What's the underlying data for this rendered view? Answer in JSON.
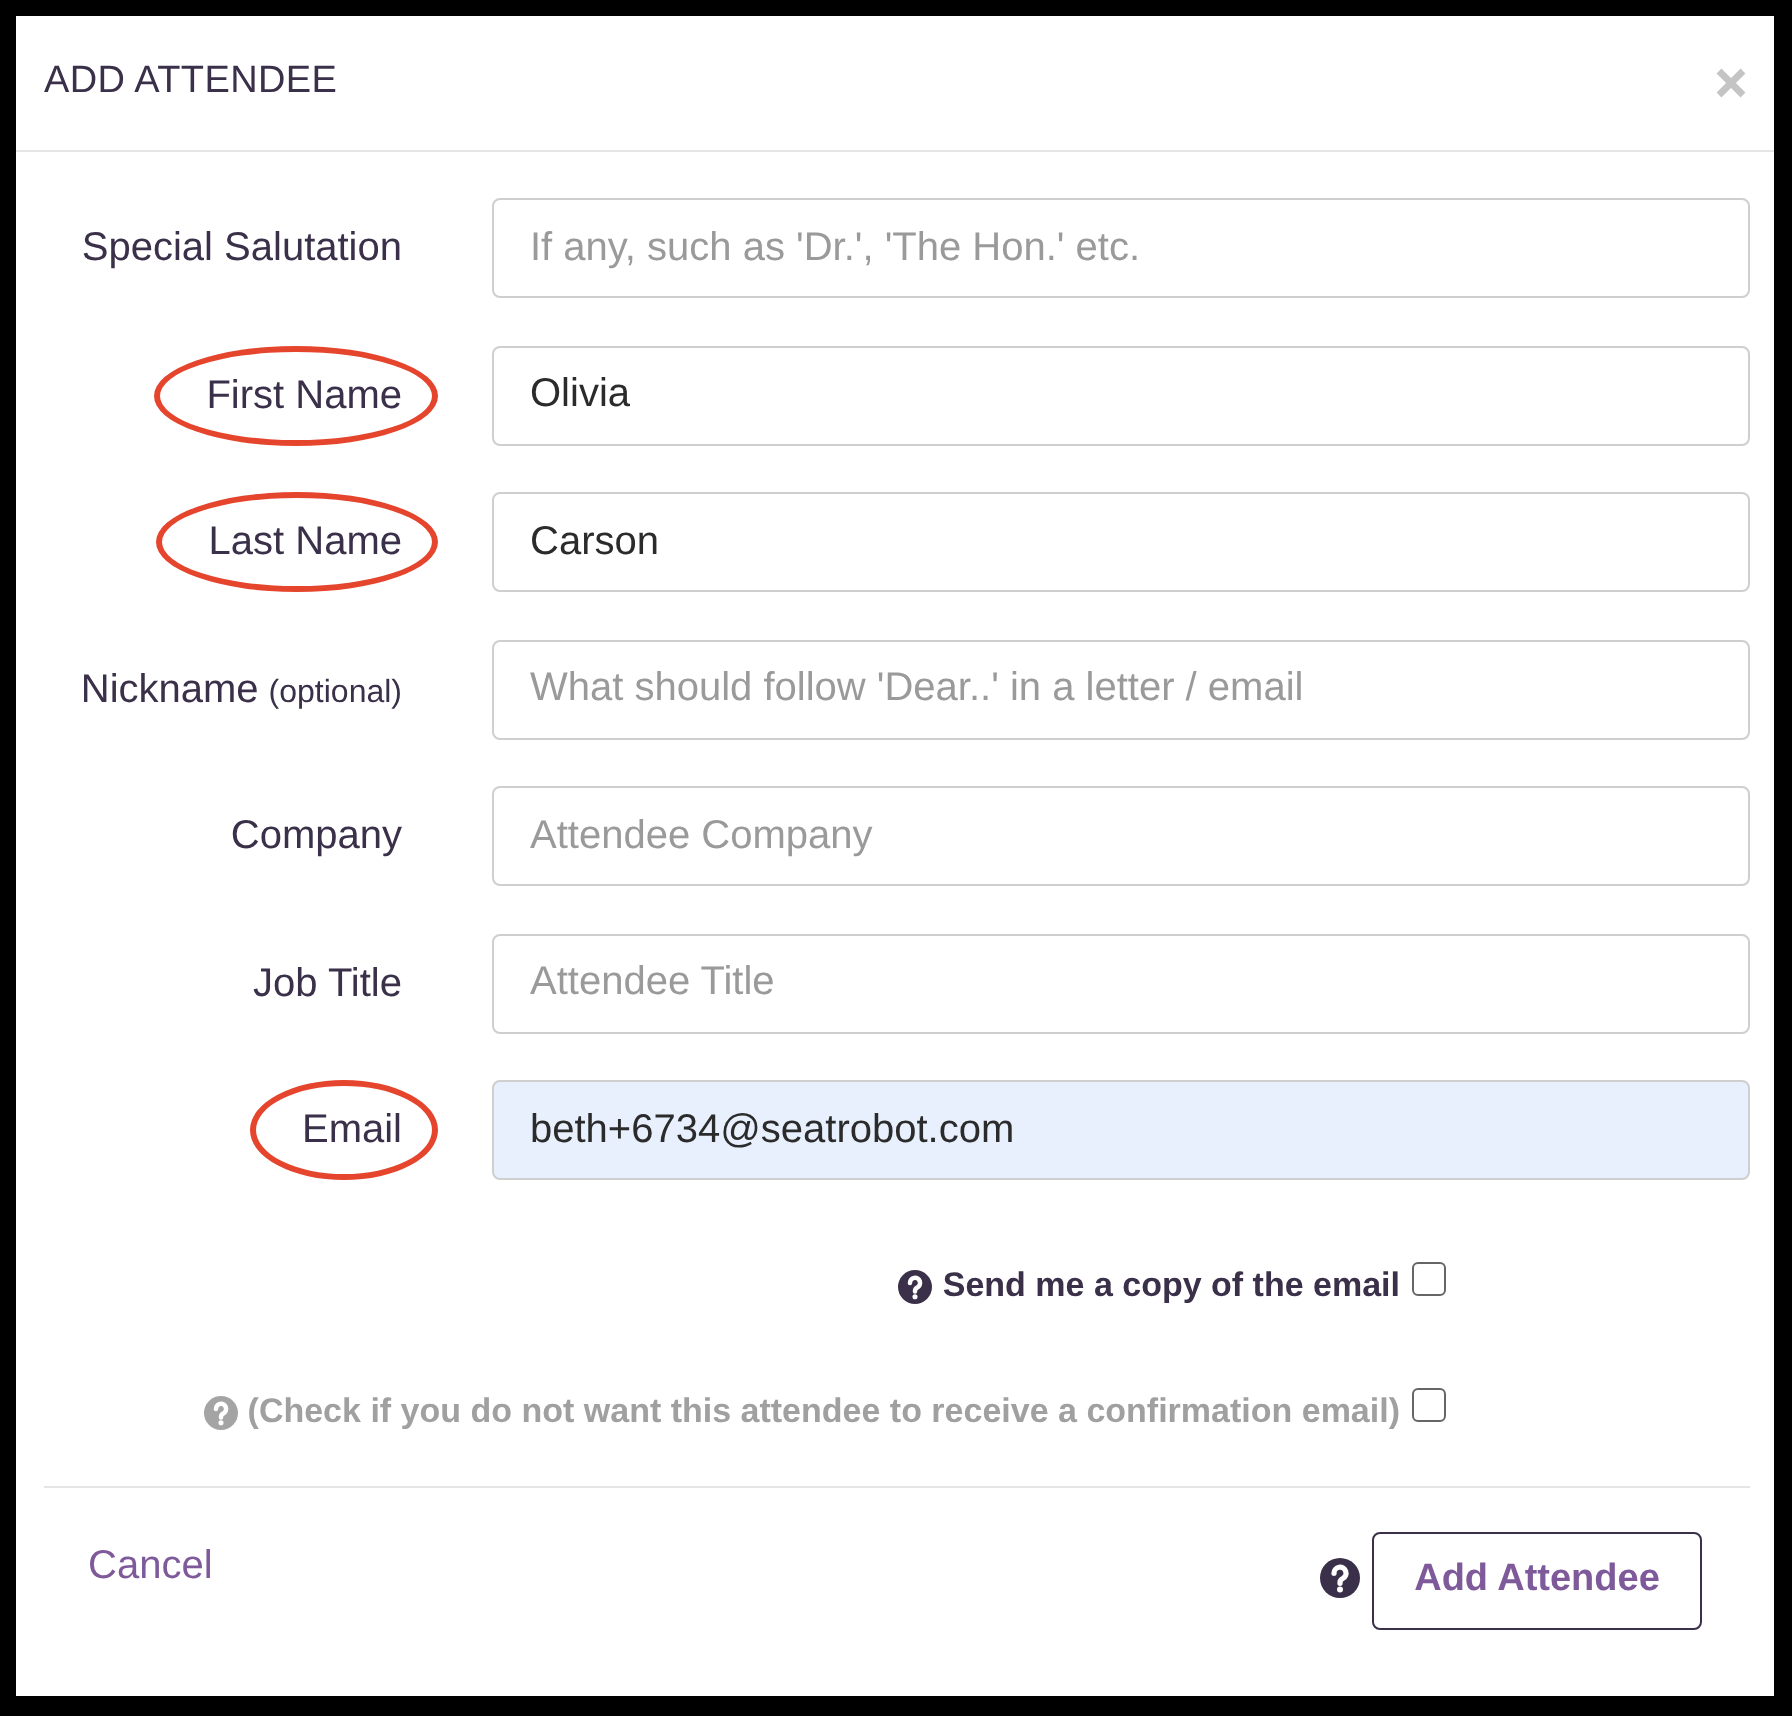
{
  "dialog": {
    "title": "ADD ATTENDEE"
  },
  "fields": [
    {
      "label": "Special Salutation",
      "placeholder": "If any, such as 'Dr.', 'The Hon.' etc.",
      "circled": false,
      "autofilled": false
    },
    {
      "label": "First Name",
      "value": "Olivia",
      "circled": true,
      "autofilled": false
    },
    {
      "label": "Last Name",
      "value": "Carson",
      "circled": true,
      "autofilled": false
    },
    {
      "label": "Nickname",
      "label_note": "(optional)",
      "placeholder": "What should follow 'Dear..' in a letter / email",
      "circled": false,
      "autofilled": false
    },
    {
      "label": "Company",
      "placeholder": "Attendee Company",
      "circled": false,
      "autofilled": false
    },
    {
      "label": "Job Title",
      "placeholder": "Attendee Title",
      "circled": false,
      "autofilled": false
    },
    {
      "label": "Email",
      "value": "beth+6734@seatrobot.com",
      "circled": true,
      "autofilled": true
    }
  ],
  "options": [
    {
      "label": "Send me a copy of the email",
      "checked": false,
      "muted": false
    },
    {
      "label": "(Check if you do not want this attendee to receive a confirmation email)",
      "checked": false,
      "muted": true
    }
  ],
  "footer": {
    "cancel": "Cancel",
    "submit": "Add Attendee"
  }
}
